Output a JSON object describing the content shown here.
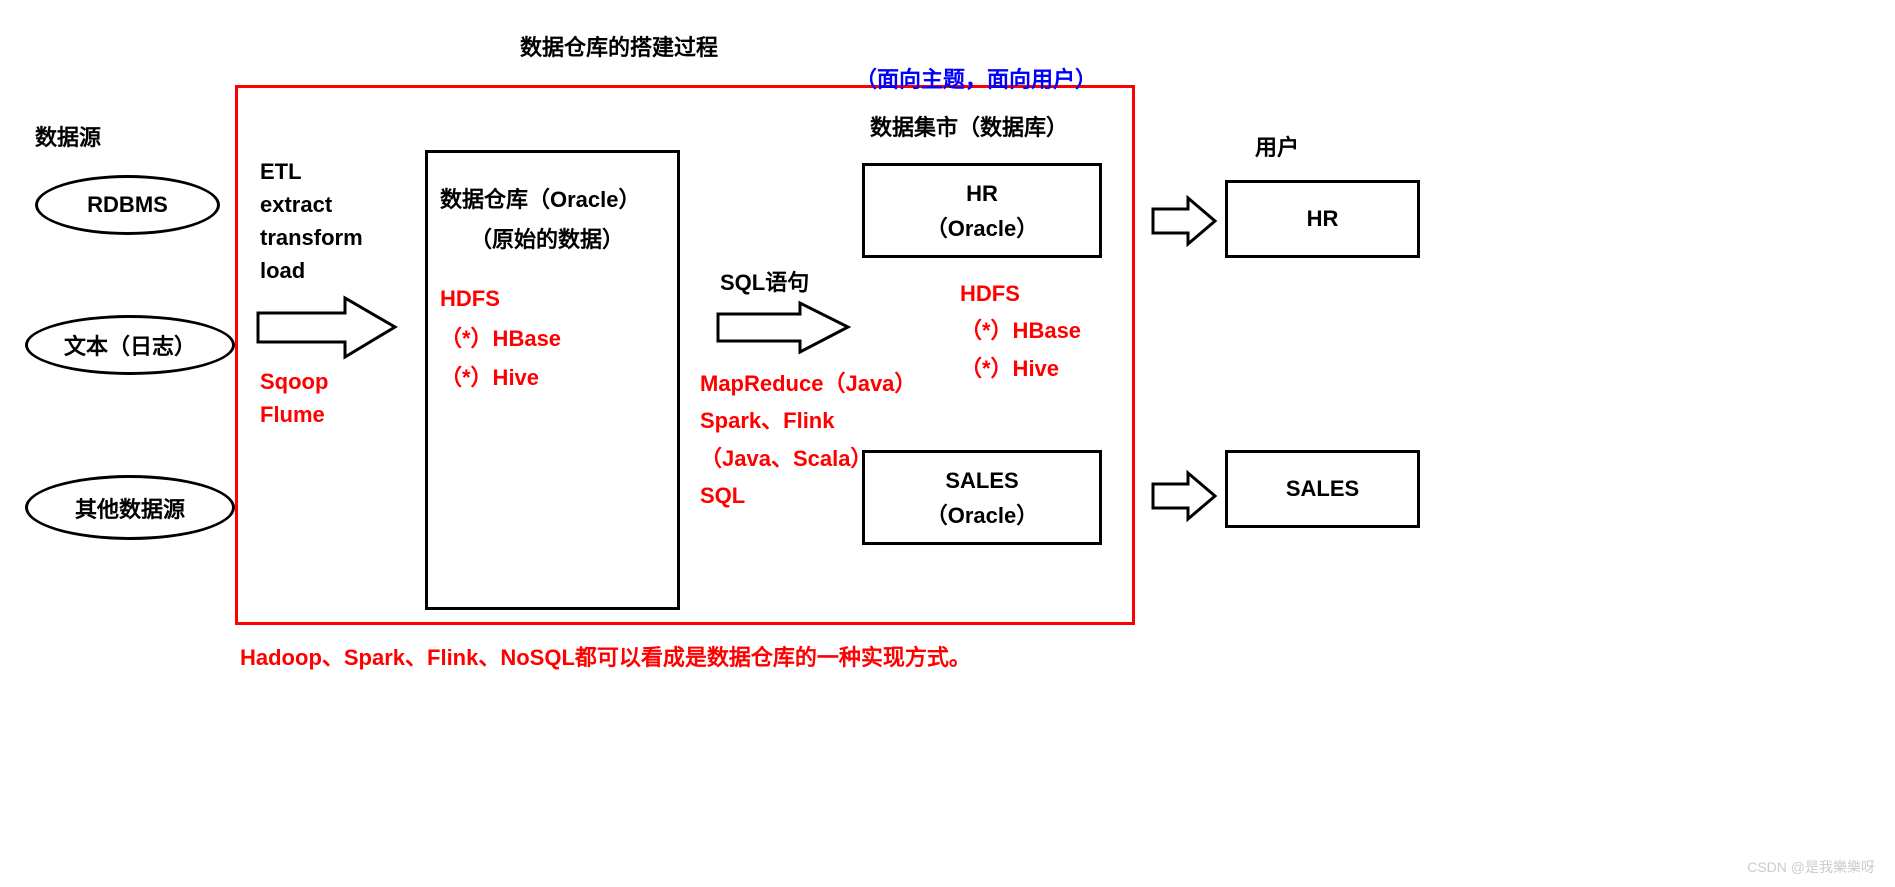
{
  "title": "数据仓库的搭建过程",
  "sections": {
    "sources_label": "数据源",
    "user_label": "用户",
    "datamart_label": "数据集市（数据库）",
    "datamart_subtitle": "（面向主题，面向用户）"
  },
  "sources": {
    "rdbms": "RDBMS",
    "text_log": "文本（日志）",
    "other": "其他数据源"
  },
  "etl": {
    "l1": "ETL",
    "l2": "extract",
    "l3": "transform",
    "l4": "load",
    "l5": "Sqoop",
    "l6": "Flume"
  },
  "warehouse": {
    "l1": "数据仓库（Oracle）",
    "l2": "（原始的数据）",
    "l3": "HDFS",
    "l4": "（*）HBase",
    "l5": "（*）Hive"
  },
  "sql_label": "SQL语句",
  "engines": {
    "l1": "MapReduce（Java）",
    "l2": "Spark、Flink",
    "l3": "（Java、Scala）",
    "l4": "SQL"
  },
  "datamarts": {
    "hr_l1": "HR",
    "hr_l2": "（Oracle）",
    "sales_l1": "SALES",
    "sales_l2": "（Oracle）",
    "tech_l1": "HDFS",
    "tech_l2": "（*）HBase",
    "tech_l3": "（*）Hive"
  },
  "users": {
    "hr": "HR",
    "sales": "SALES"
  },
  "footer": "Hadoop、Spark、Flink、NoSQL都可以看成是数据仓库的一种实现方式。",
  "watermark": "CSDN @是我樂樂呀"
}
